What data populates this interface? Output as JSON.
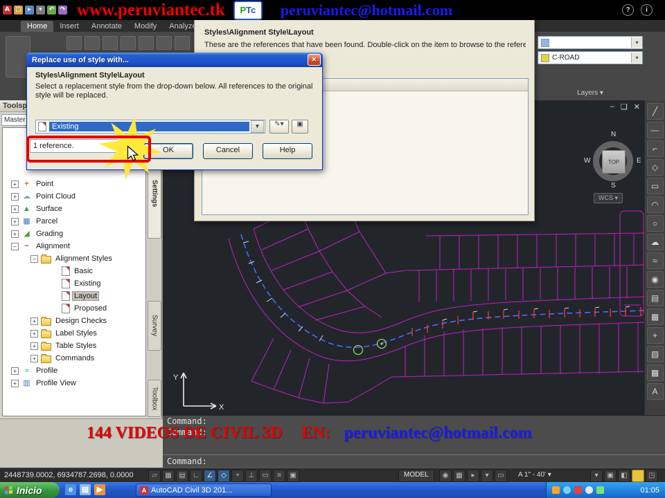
{
  "topbar": {
    "url": "www.peruviantec.tk",
    "email": "peruviantec@hotmail.com",
    "logo_p": "P",
    "logo_tc": "Tc",
    "help": "?",
    "info": "i"
  },
  "ribbon": {
    "tabs": [
      {
        "label": "Home",
        "active": true
      },
      {
        "label": "Insert",
        "active": false
      },
      {
        "label": "Annotate",
        "active": false
      },
      {
        "label": "Modify",
        "active": false
      },
      {
        "label": "Analyze",
        "active": false
      }
    ],
    "layer_combo_value": "C-ROAD",
    "layers_panel_label": "Layers",
    "panel_drop_arrow": "▾"
  },
  "dialog_references": {
    "heading": "Styles\\Alignment Style\\Layout",
    "description": "These are the references that have been found.  Double-click on the item to browse to the reference in"
  },
  "dialog_replace": {
    "title": "Replace use of style with...",
    "close": "✕",
    "heading": "Styles\\Alignment Style\\Layout",
    "description": "Select a replacement style from the drop-down below.  All references to the original style will be replaced.",
    "combo_value": "Existing",
    "reference_count": "1 reference.",
    "ok": "OK",
    "cancel": "Cancel",
    "help": "Help"
  },
  "toolspace": {
    "title": "Toolspace",
    "view_selector": "Master",
    "side_tabs": [
      {
        "label": "Settings",
        "active": true
      },
      {
        "label": "Survey",
        "active": false
      },
      {
        "label": "Toolbox",
        "active": false
      }
    ],
    "tree_icon_glyphs": {
      "point": "+",
      "point-cloud": "☁",
      "surface": "▲",
      "parcel": "▦",
      "grading": "◢",
      "alignment": "~",
      "profile": "≈",
      "profile-view": "▥"
    },
    "tree": [
      {
        "label": "Point",
        "icon": "point",
        "expander": "plus",
        "indent": 0
      },
      {
        "label": "Point Cloud",
        "icon": "point-cloud",
        "expander": "plus",
        "indent": 0
      },
      {
        "label": "Surface",
        "icon": "surface",
        "expander": "plus",
        "indent": 0
      },
      {
        "label": "Parcel",
        "icon": "parcel",
        "expander": "plus",
        "indent": 0
      },
      {
        "label": "Grading",
        "icon": "grading",
        "expander": "plus",
        "indent": 0
      },
      {
        "label": "Alignment",
        "icon": "alignment",
        "expander": "minus",
        "indent": 0
      },
      {
        "label": "Alignment Styles",
        "icon": "folder",
        "expander": "minus",
        "indent": 1
      },
      {
        "label": "Basic",
        "icon": "style",
        "expander": "none",
        "indent": 2
      },
      {
        "label": "Existing",
        "icon": "style",
        "expander": "none",
        "indent": 2
      },
      {
        "label": "Layout",
        "icon": "style",
        "expander": "none",
        "indent": 2,
        "selected": true
      },
      {
        "label": "Proposed",
        "icon": "style",
        "expander": "none",
        "indent": 2
      },
      {
        "label": "Design Checks",
        "icon": "folder",
        "expander": "plus",
        "indent": 1
      },
      {
        "label": "Label Styles",
        "icon": "folder",
        "expander": "plus",
        "indent": 1
      },
      {
        "label": "Table Styles",
        "icon": "folder",
        "expander": "plus",
        "indent": 1
      },
      {
        "label": "Commands",
        "icon": "folder",
        "expander": "plus",
        "indent": 1
      },
      {
        "label": "Profile",
        "icon": "profile",
        "expander": "plus",
        "indent": 0
      },
      {
        "label": "Profile View",
        "icon": "profile-view",
        "expander": "plus",
        "indent": 0
      }
    ]
  },
  "viewport": {
    "compass": {
      "n": "N",
      "e": "E",
      "s": "S",
      "w": "W",
      "center": "TOP"
    },
    "wcs": "WCS ▾",
    "axis_x": "X",
    "axis_y": "Y",
    "minimize": "–",
    "restore": "❏",
    "close": "✕"
  },
  "right_toolbar_icons": [
    {
      "name": "line-icon",
      "glyph": "╱"
    },
    {
      "name": "construction-line-icon",
      "glyph": "—"
    },
    {
      "name": "polyline-icon",
      "glyph": "⌐"
    },
    {
      "name": "polygon-icon",
      "glyph": "◇"
    },
    {
      "name": "rectangle-icon",
      "glyph": "▭"
    },
    {
      "name": "arc-icon",
      "glyph": "◠"
    },
    {
      "name": "circle-icon",
      "glyph": "○"
    },
    {
      "name": "revision-cloud-icon",
      "glyph": "☁"
    },
    {
      "name": "spline-icon",
      "glyph": "≈"
    },
    {
      "name": "ellipse-icon",
      "glyph": "◉"
    },
    {
      "name": "insert-block-icon",
      "glyph": "▤"
    },
    {
      "name": "create-block-icon",
      "glyph": "▦"
    },
    {
      "name": "point-icon",
      "glyph": "+"
    },
    {
      "name": "hatch-icon",
      "glyph": "▨"
    },
    {
      "name": "gradient-icon",
      "glyph": "▩"
    },
    {
      "name": "text-icon",
      "glyph": "A"
    }
  ],
  "command": {
    "lines": [
      "Command:",
      "Command:",
      "Command:"
    ]
  },
  "banner": {
    "red": "144 VIDEOS DE CIVIL 3D",
    "en": "EN:",
    "email": "peruviantec@hotmail.com"
  },
  "statusbar": {
    "coordinates": "2448739.0002, 6934787.2698, 0.0000",
    "model": "MODEL",
    "scale": "A 1\" - 40'  ▾",
    "toggles": [
      {
        "name": "infer-constraints-icon",
        "glyph": "▱",
        "active": false
      },
      {
        "name": "snap-icon",
        "glyph": "▦",
        "active": false
      },
      {
        "name": "grid-icon",
        "glyph": "▤",
        "active": false
      },
      {
        "name": "ortho-icon",
        "glyph": "∟",
        "active": false
      },
      {
        "name": "polar-tracking-icon",
        "glyph": "∠",
        "active": true
      },
      {
        "name": "object-snap-icon",
        "glyph": "◇",
        "active": true
      },
      {
        "name": "object-track-icon",
        "glyph": "+",
        "active": false
      },
      {
        "name": "ducs-icon",
        "glyph": "⊥",
        "active": false
      },
      {
        "name": "dynamic-input-icon",
        "glyph": "▭",
        "active": false
      },
      {
        "name": "lineweight-icon",
        "glyph": "≡",
        "active": false
      },
      {
        "name": "quick-properties-icon",
        "glyph": "▣",
        "active": false
      }
    ],
    "right_icons": [
      {
        "name": "quick-view-layouts-icon",
        "glyph": "◉"
      },
      {
        "name": "quick-view-drawings-icon",
        "glyph": "▦"
      },
      {
        "name": "steering-wheel-icon",
        "glyph": "▸"
      },
      {
        "name": "show-motion-icon",
        "glyph": "▾"
      },
      {
        "name": "pan-icon",
        "glyph": "▭"
      }
    ],
    "far_icons": [
      {
        "name": "workspace-switch-icon",
        "glyph": "▾"
      },
      {
        "name": "lock-ui-icon",
        "glyph": "▣"
      },
      {
        "name": "hardware-accel-icon",
        "glyph": "◧"
      },
      {
        "name": "annotation-monitor-icon",
        "glyph": "",
        "yellow": true
      },
      {
        "name": "cleanscreen-icon",
        "glyph": "◳"
      }
    ]
  },
  "taskbar": {
    "start": "Inicio",
    "task": "AutoCAD Civil 3D 201...",
    "time": "01:05",
    "quick_launch": [
      {
        "name": "internet-explorer-icon",
        "glyph": "e",
        "color": "#4a90e8"
      },
      {
        "name": "show-desktop-icon",
        "glyph": "▤",
        "color": "#8fb8e8"
      },
      {
        "name": "media-player-icon",
        "glyph": "▶",
        "color": "#e8963c"
      }
    ],
    "tray_icons": [
      {
        "name": "update-tray-icon",
        "color": "#f6a623",
        "round": false
      },
      {
        "name": "network-tray-icon",
        "color": "#7ad0ff",
        "round": true
      },
      {
        "name": "security-tray-icon",
        "color": "#e04343",
        "round": false
      },
      {
        "name": "volume-tray-icon",
        "color": "#e8e8e8",
        "round": true
      },
      {
        "name": "messenger-tray-icon",
        "color": "#7de07d",
        "round": false
      }
    ]
  },
  "qat_icons": [
    {
      "name": "autocad-logo-icon",
      "glyph": "A",
      "color": "#c03030"
    },
    {
      "name": "new-icon",
      "glyph": "▢",
      "color": "#caa24a"
    },
    {
      "name": "open-icon",
      "glyph": "▸",
      "color": "#5a87c6"
    },
    {
      "name": "save-icon",
      "glyph": "▾",
      "color": "#7a7a7a"
    },
    {
      "name": "undo-icon",
      "glyph": "↶",
      "color": "#6aa84f"
    },
    {
      "name": "redo-icon",
      "glyph": "↷",
      "color": "#9a6fc0"
    }
  ]
}
